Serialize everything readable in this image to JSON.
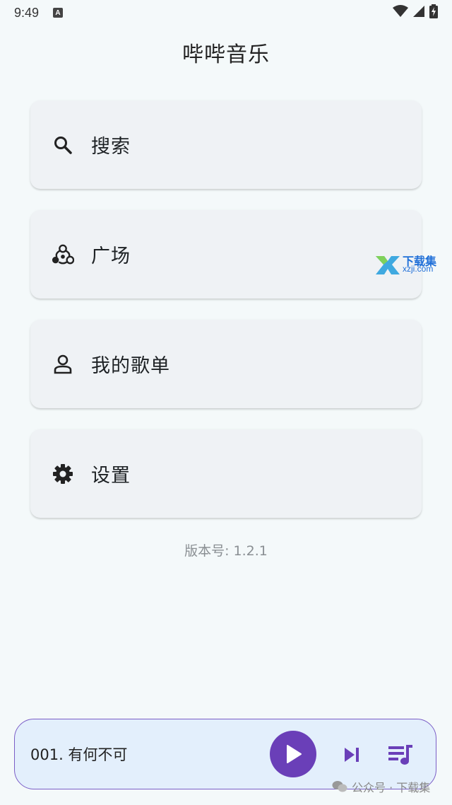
{
  "status_bar": {
    "time": "9:49",
    "notification_icon": "A"
  },
  "app": {
    "title": "哔哔音乐"
  },
  "menu": [
    {
      "label": "搜索",
      "icon": "search-icon"
    },
    {
      "label": "广场",
      "icon": "hub-icon"
    },
    {
      "label": "我的歌单",
      "icon": "person-icon"
    },
    {
      "label": "设置",
      "icon": "gear-icon"
    }
  ],
  "version_text": "版本号: 1.2.1",
  "player": {
    "song": "001. 有何不可",
    "accent_color": "#6a3fb8"
  },
  "watermarks": {
    "top_line1": "下载集",
    "top_line2": "xzji.com",
    "bottom": "公众号 · 下载集"
  }
}
